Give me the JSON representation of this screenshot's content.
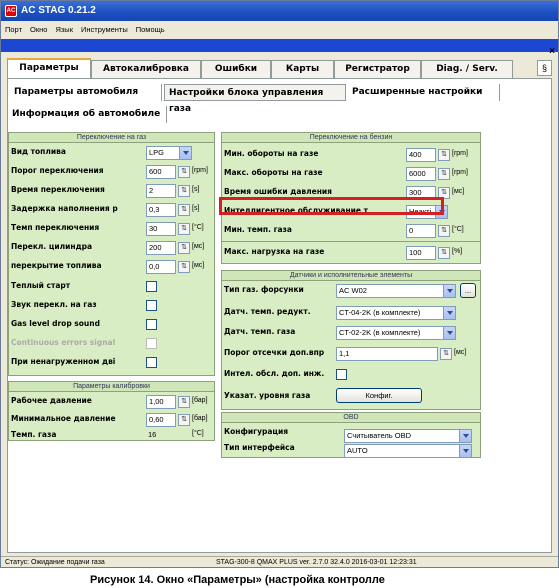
{
  "window": {
    "title": "AC STAG 0.21.2",
    "icon": "stag-logo-icon"
  },
  "menu": [
    "Порт",
    "Окно",
    "Язык",
    "Инструменты",
    "Помощь"
  ],
  "tabs_main": [
    "Параметры",
    "Автокалибровка",
    "Ошибки",
    "Карты",
    "Регистратор",
    "Diag. / Serv."
  ],
  "tabs_sub": [
    "Параметры автомобиля",
    "Настройки блока управления газа",
    "Расширенные настройки"
  ],
  "tab_info": "Информация об автомобиле",
  "switch_gas": {
    "title": "Переключение на газ",
    "rows": [
      {
        "label": "Вид топлива",
        "value": "LPG",
        "unit": ""
      },
      {
        "label": "Порог переключения",
        "value": "600",
        "unit": "[rpm]"
      },
      {
        "label": "Время переключения",
        "value": "2",
        "unit": "[s]"
      },
      {
        "label": "Задержка наполнения р",
        "value": "0,3",
        "unit": "[s]"
      },
      {
        "label": "Темп переключения",
        "value": "30",
        "unit": "[°C]"
      },
      {
        "label": "Перекл. цилиндра",
        "value": "200",
        "unit": "[мс]"
      },
      {
        "label": "перекрытие топлива",
        "value": "0,0",
        "unit": "[мс]"
      }
    ],
    "checks": [
      "Теплый старт",
      "Звук перекл. на газ",
      "Gas level drop sound",
      "Continuous errors signal",
      "При ненагруженном дві"
    ]
  },
  "calib": {
    "title": "Параметры калибровки",
    "rows": [
      {
        "label": "Рабочее давление",
        "value": "1,00",
        "unit": "[бар]"
      },
      {
        "label": "Минимальное давление",
        "value": "0,60",
        "unit": "[бар]"
      },
      {
        "label": "Темп. газа",
        "value": "16",
        "unit": "[°C]"
      }
    ]
  },
  "switch_petrol": {
    "title": "Переключение на бензин",
    "rows": [
      {
        "label": "Мин. обороты на газе",
        "value": "400",
        "unit": "[rpm]"
      },
      {
        "label": "Макс. обороты на газе",
        "value": "6000",
        "unit": "[rpm]"
      },
      {
        "label": "Время ошибки давления",
        "value": "300",
        "unit": "[мс]"
      },
      {
        "label": "Интеллигентное обслуживание т",
        "value": "Неакті",
        "unit": ""
      },
      {
        "label": "Мин. темп. газа",
        "value": "0",
        "unit": "[°C]"
      },
      {
        "label": "Макс. нагрузка на газе",
        "value": "100",
        "unit": "[%]"
      }
    ]
  },
  "sensors": {
    "title": "Датчики и исполнительные элементы",
    "rows": [
      {
        "label": "Тип газ. форсунки",
        "value": "AC W02"
      },
      {
        "label": "Датч. темп. редукт.",
        "value": "CT-04-2K (в комплекте)"
      },
      {
        "label": "Датч. темп. газа",
        "value": "CT-02-2K (в комплекте)"
      },
      {
        "label": "Порог отсечки доп.впр",
        "value": "1,1",
        "unit": "[мс]"
      },
      {
        "label": "Интел. обсл. доп. инж."
      },
      {
        "label": "Указат. уровня газа",
        "button": "Конфиг."
      }
    ],
    "more_button": "..."
  },
  "obd": {
    "title": "OBD",
    "rows": [
      {
        "label": "Конфигурация",
        "value": "Считыватель OBD"
      },
      {
        "label": "Тип интерфейса",
        "value": "AUTO"
      }
    ]
  },
  "status": {
    "left": "Статус: Ожидание подачи газа",
    "right": "STAG-300-8 QMAX PLUS  ver. 2.7.0  32.4.0  2016-03-01 12:23:31"
  },
  "caption": "Рисунок 14.      Окно «Параметры» (настройка контролле"
}
